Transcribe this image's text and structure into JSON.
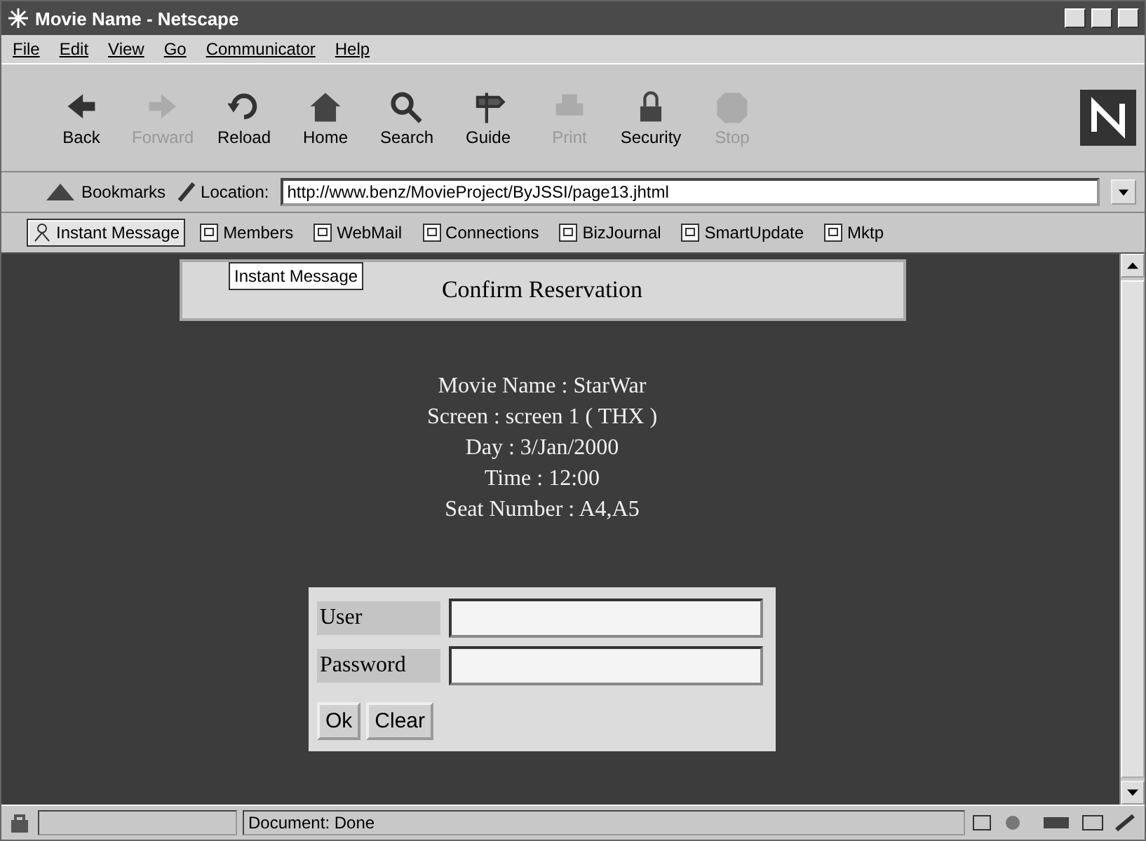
{
  "window": {
    "title": "Movie Name - Netscape"
  },
  "menu": [
    "File",
    "Edit",
    "View",
    "Go",
    "Communicator",
    "Help"
  ],
  "toolbar": [
    {
      "label": "Back",
      "disabled": false
    },
    {
      "label": "Forward",
      "disabled": true
    },
    {
      "label": "Reload",
      "disabled": false
    },
    {
      "label": "Home",
      "disabled": false
    },
    {
      "label": "Search",
      "disabled": false
    },
    {
      "label": "Guide",
      "disabled": false
    },
    {
      "label": "Print",
      "disabled": true
    },
    {
      "label": "Security",
      "disabled": false
    },
    {
      "label": "Stop",
      "disabled": true
    }
  ],
  "location_bar": {
    "bookmarks": "Bookmarks",
    "label": "Location:",
    "url": "http://www.benz/MovieProject/ByJSSI/page13.jhtml"
  },
  "personal_toolbar": [
    {
      "label": "Instant Message",
      "selected": true
    },
    {
      "label": "Members",
      "selected": false
    },
    {
      "label": "WebMail",
      "selected": false
    },
    {
      "label": "Connections",
      "selected": false
    },
    {
      "label": "BizJournal",
      "selected": false
    },
    {
      "label": "SmartUpdate",
      "selected": false
    },
    {
      "label": "Mktp",
      "selected": false
    }
  ],
  "tooltip": "Instant Message",
  "page": {
    "heading": "Confirm Reservation",
    "details": [
      "Movie Name : StarWar",
      "Screen : screen 1 ( THX )",
      "Day : 3/Jan/2000",
      "Time : 12:00",
      "Seat Number : A4,A5"
    ],
    "form": {
      "fields": [
        {
          "label": "User"
        },
        {
          "label": "Password"
        }
      ],
      "buttons": [
        "Ok",
        "Clear"
      ]
    }
  },
  "status_bar": {
    "text": "Document: Done"
  }
}
